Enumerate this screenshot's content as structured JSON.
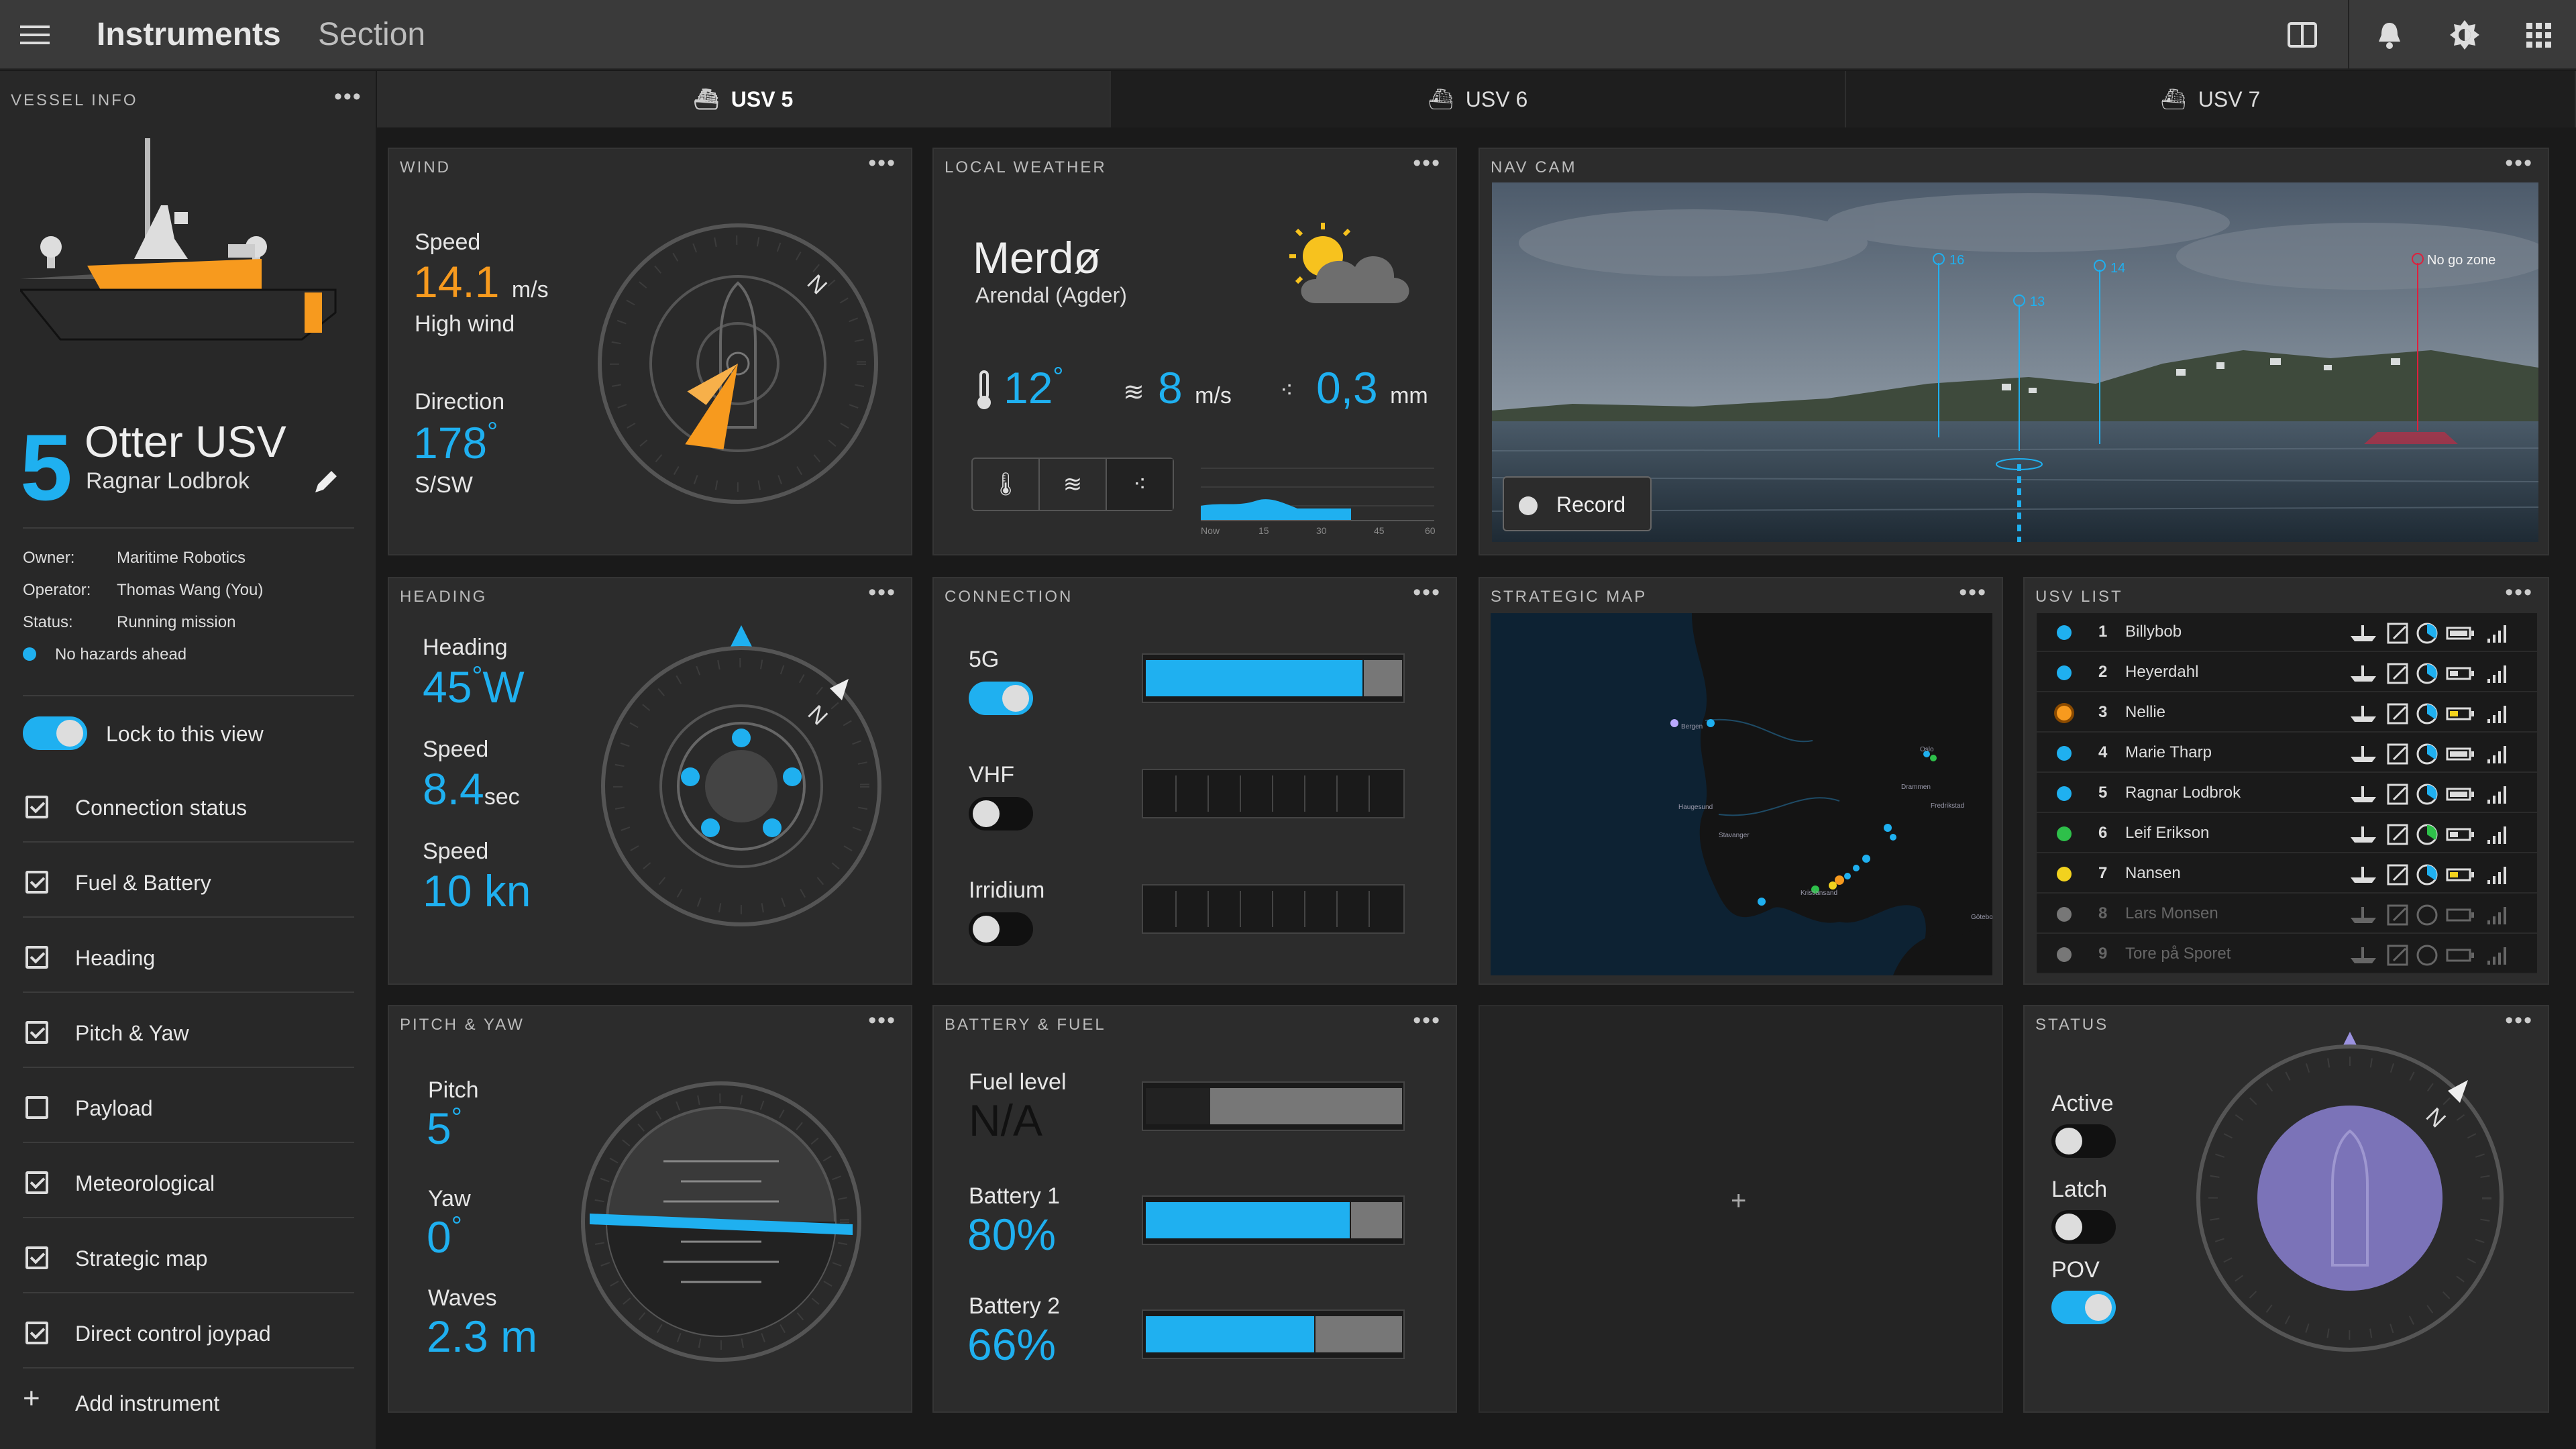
{
  "header": {
    "title": "Instruments",
    "subtitle": "Section"
  },
  "sidebar": {
    "heading": "VESSEL INFO",
    "vessel_number": "5",
    "vessel_name": "Otter USV",
    "operator_name": "Ragnar Lodbrok",
    "owner_label": "Owner:",
    "owner": "Maritime Robotics",
    "operator_label": "Operator:",
    "operator": "Thomas Wang (You)",
    "status_label": "Status:",
    "status": "Running mission",
    "hazard": "No hazards ahead",
    "lock_label": "Lock to this view",
    "lock_on": true,
    "items": [
      {
        "label": "Connection status",
        "checked": true
      },
      {
        "label": "Fuel & Battery",
        "checked": true
      },
      {
        "label": "Heading",
        "checked": true
      },
      {
        "label": "Pitch & Yaw",
        "checked": true
      },
      {
        "label": "Payload",
        "checked": false
      },
      {
        "label": "Meteorological",
        "checked": true
      },
      {
        "label": "Strategic map",
        "checked": true
      },
      {
        "label": "Direct control joypad",
        "checked": true
      }
    ],
    "add_label": "Add instrument"
  },
  "tabs": [
    {
      "label": "USV 5",
      "active": true
    },
    {
      "label": "USV 6",
      "active": false
    },
    {
      "label": "USV 7",
      "active": false
    }
  ],
  "wind": {
    "title": "WIND",
    "speed_label": "Speed",
    "speed": "14.1",
    "speed_unit": "m/s",
    "speed_note": "High wind",
    "dir_label": "Direction",
    "dir": "178",
    "dir_deg": "°",
    "dir_text": "S/SW",
    "north": "N"
  },
  "weather": {
    "title": "LOCAL WEATHER",
    "place": "Merdø",
    "region": "Arendal (Agder)",
    "temp": "12",
    "temp_deg": "°",
    "wind": "8",
    "wind_unit": "m/s",
    "rain": "0,3",
    "rain_unit": "mm",
    "axis": [
      "Now",
      "15",
      "30",
      "45",
      "60"
    ]
  },
  "navcam": {
    "title": "NAV CAM",
    "markers": [
      "16",
      "13",
      "14"
    ],
    "zone_label": "No go zone",
    "record_label": "Record"
  },
  "heading": {
    "title": "HEADING",
    "heading_label": "Heading",
    "heading": "45",
    "heading_deg": "°",
    "heading_dir": "W",
    "speed1_label": "Speed",
    "speed1": "8.4",
    "speed1_unit": "sec",
    "speed2_label": "Speed",
    "speed2": "10 kn",
    "north": "N"
  },
  "connection": {
    "title": "CONNECTION",
    "links": [
      {
        "label": "5G",
        "on": true,
        "level": 0.85
      },
      {
        "label": "VHF",
        "on": false,
        "level": 0
      },
      {
        "label": "Irridium",
        "on": false,
        "level": 0
      }
    ]
  },
  "map": {
    "title": "STRATEGIC MAP",
    "cities": [
      "Bergen",
      "Oslo",
      "Haugesund",
      "Drammen",
      "Stavanger",
      "Fredrikstad",
      "Kristiansand",
      "Göteborg"
    ]
  },
  "usv_list": {
    "title": "USV LIST",
    "rows": [
      {
        "n": "1",
        "name": "Billybob",
        "color": "#1fb0f0",
        "dim": false
      },
      {
        "n": "2",
        "name": "Heyerdahl",
        "color": "#1fb0f0",
        "dim": false
      },
      {
        "n": "3",
        "name": "Nellie",
        "color": "#f79a1e",
        "dim": false
      },
      {
        "n": "4",
        "name": "Marie Tharp",
        "color": "#1fb0f0",
        "dim": false
      },
      {
        "n": "5",
        "name": "Ragnar Lodbrok",
        "color": "#1fb0f0",
        "dim": false
      },
      {
        "n": "6",
        "name": "Leif Erikson",
        "color": "#2ec04a",
        "dim": false
      },
      {
        "n": "7",
        "name": "Nansen",
        "color": "#f2d21e",
        "dim": false
      },
      {
        "n": "8",
        "name": "Lars Monsen",
        "color": "#777777",
        "dim": true
      },
      {
        "n": "9",
        "name": "Tore på Sporet",
        "color": "#777777",
        "dim": true
      }
    ]
  },
  "pitch": {
    "title": "PITCH & YAW",
    "pitch_label": "Pitch",
    "pitch": "5",
    "pitch_deg": "°",
    "yaw_label": "Yaw",
    "yaw": "0",
    "yaw_deg": "°",
    "waves_label": "Waves",
    "waves": "2.3 m"
  },
  "battery": {
    "title": "BATTERY & FUEL",
    "fuel_label": "Fuel level",
    "fuel": "N/A",
    "b1_label": "Battery 1",
    "b1": "80%",
    "b1_level": 0.8,
    "b2_label": "Battery 2",
    "b2": "66%",
    "b2_level": 0.66
  },
  "empty": {
    "add": "+"
  },
  "status": {
    "title": "STATUS",
    "active_label": "Active",
    "active_on": false,
    "latch_label": "Latch",
    "latch_on": false,
    "pov_label": "POV",
    "pov_on": true,
    "north": "N"
  },
  "colors": {
    "accent": "#1fb0f0",
    "warn": "#f79a1e",
    "panel": "#2c2c2c",
    "status_disc": "#7b73b8"
  }
}
